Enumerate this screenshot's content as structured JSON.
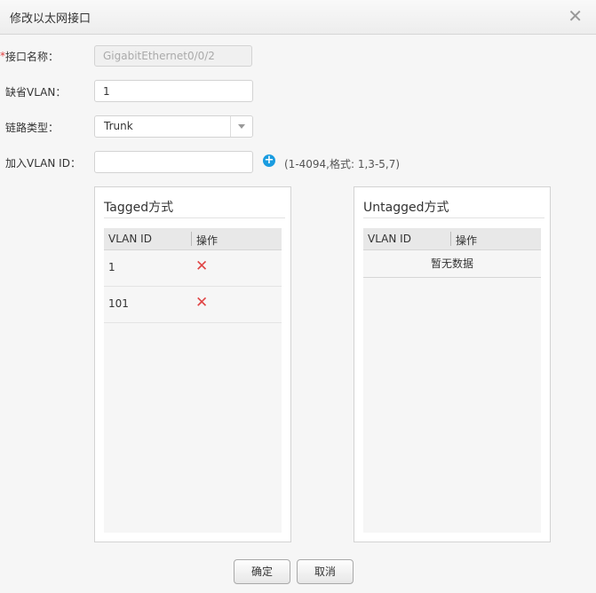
{
  "dialog": {
    "title": "修改以太网接口"
  },
  "form": {
    "required_mark": "*",
    "name_label": "接口名称：",
    "name_value": "GigabitEthernet0/0/2",
    "default_vlan_label": "缺省VLAN：",
    "default_vlan_value": "1",
    "link_type_label": "链路类型：",
    "link_type_value": "Trunk",
    "join_vlan_label": "加入VLAN ID：",
    "join_vlan_value": "",
    "add_symbol": "+",
    "hint": "(1-4094,格式: 1,3-5,7)"
  },
  "tagged": {
    "title": "Tagged方式",
    "col_vlan": "VLAN ID",
    "col_action": "操作",
    "rows": [
      {
        "vlan": "1",
        "delete_symbol": "✕"
      },
      {
        "vlan": "101",
        "delete_symbol": "✕"
      }
    ]
  },
  "untagged": {
    "title": "Untagged方式",
    "col_vlan": "VLAN ID",
    "col_action": "操作",
    "empty_text": "暂无数据"
  },
  "footer": {
    "ok_label": "确定",
    "cancel_label": "取消"
  },
  "colors": {
    "accent": "#1a9ce0",
    "delete": "#e04545",
    "required": "#e04040"
  }
}
